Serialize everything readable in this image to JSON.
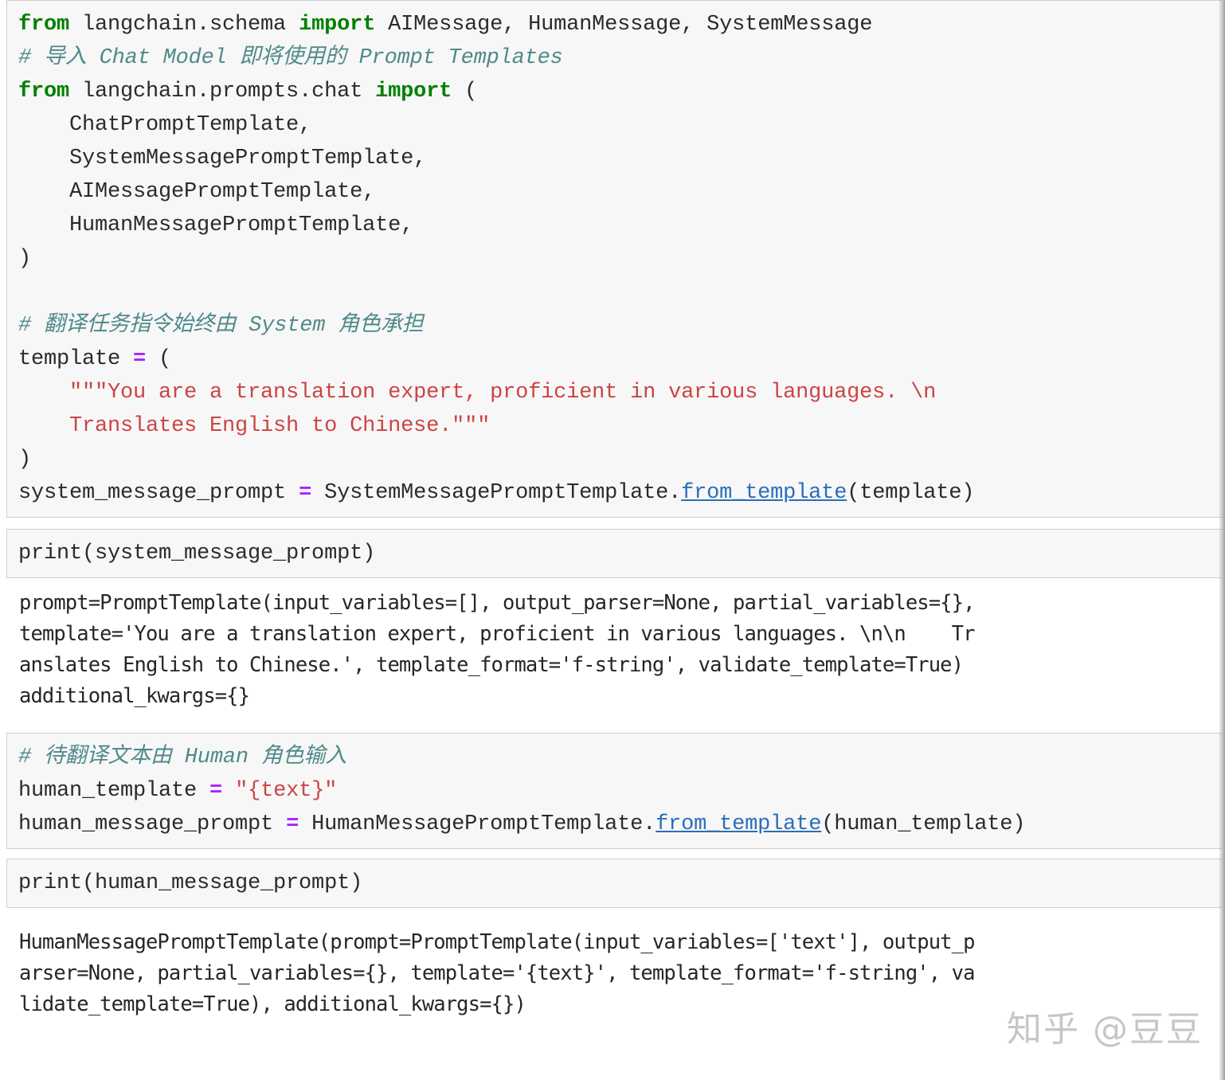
{
  "colors": {
    "keyword": "#008000",
    "comment": "#4f8a8b",
    "string": "#cc4444",
    "operator": "#aa22ff",
    "function": "#2a6ebb",
    "code_cell_bg": "#f7f7f7",
    "code_cell_border": "#cfcfcf",
    "page_bg": "#ffffff",
    "text": "#2b2b2b"
  },
  "watermark": {
    "text": "知乎 @豆豆"
  },
  "cells": [
    {
      "type": "code",
      "name": "code-cell-imports-and-system-template",
      "lines": [
        [
          {
            "t": "from",
            "c": "k"
          },
          {
            "t": " langchain.schema ",
            "c": ""
          },
          {
            "t": "import",
            "c": "k"
          },
          {
            "t": " AIMessage, HumanMessage, SystemMessage",
            "c": ""
          }
        ],
        [
          {
            "t": "# 导入 Chat Model 即将使用的 Prompt Templates",
            "c": "cm"
          }
        ],
        [
          {
            "t": "from",
            "c": "k"
          },
          {
            "t": " langchain.prompts.chat ",
            "c": ""
          },
          {
            "t": "import",
            "c": "k"
          },
          {
            "t": " (",
            "c": ""
          }
        ],
        [
          {
            "t": "    ChatPromptTemplate,",
            "c": ""
          }
        ],
        [
          {
            "t": "    SystemMessagePromptTemplate,",
            "c": ""
          }
        ],
        [
          {
            "t": "    AIMessagePromptTemplate,",
            "c": ""
          }
        ],
        [
          {
            "t": "    HumanMessagePromptTemplate,",
            "c": ""
          }
        ],
        [
          {
            "t": ")",
            "c": ""
          }
        ],
        [
          {
            "t": "",
            "c": ""
          }
        ],
        [
          {
            "t": "# 翻译任务指令始终由 System 角色承担",
            "c": "cm"
          }
        ],
        [
          {
            "t": "template ",
            "c": ""
          },
          {
            "t": "=",
            "c": "op"
          },
          {
            "t": " (",
            "c": ""
          }
        ],
        [
          {
            "t": "    \"\"\"You are a translation expert, proficient in various languages. \\n",
            "c": "s"
          }
        ],
        [
          {
            "t": "    Translates English to Chinese.\"\"\"",
            "c": "s"
          }
        ],
        [
          {
            "t": ")",
            "c": ""
          }
        ],
        [
          {
            "t": "system_message_prompt ",
            "c": ""
          },
          {
            "t": "=",
            "c": "op"
          },
          {
            "t": " SystemMessagePromptTemplate.",
            "c": ""
          },
          {
            "t": "from_template",
            "c": "fn"
          },
          {
            "t": "(template)",
            "c": ""
          }
        ]
      ]
    },
    {
      "type": "code",
      "name": "code-cell-print-system-message-prompt",
      "lines": [
        [
          {
            "t": "print(system_message_prompt)",
            "c": ""
          }
        ]
      ]
    },
    {
      "type": "output",
      "name": "output-cell-system-message-prompt",
      "lines": [
        "prompt=PromptTemplate(input_variables=[], output_parser=None, partial_variables={},",
        "template='You are a translation expert, proficient in various languages. \\n\\n    Tr",
        "anslates English to Chinese.', template_format='f-string', validate_template=True)",
        "additional_kwargs={}"
      ]
    },
    {
      "type": "code",
      "name": "code-cell-human-template",
      "lines": [
        [
          {
            "t": "# 待翻译文本由 Human 角色输入",
            "c": "cm"
          }
        ],
        [
          {
            "t": "human_template ",
            "c": ""
          },
          {
            "t": "=",
            "c": "op"
          },
          {
            "t": " ",
            "c": ""
          },
          {
            "t": "\"{text}\"",
            "c": "s"
          }
        ],
        [
          {
            "t": "human_message_prompt ",
            "c": ""
          },
          {
            "t": "=",
            "c": "op"
          },
          {
            "t": " HumanMessagePromptTemplate.",
            "c": ""
          },
          {
            "t": "from_template",
            "c": "fn"
          },
          {
            "t": "(human_template)",
            "c": ""
          }
        ]
      ]
    },
    {
      "type": "code",
      "name": "code-cell-print-human-message-prompt",
      "lines": [
        [
          {
            "t": "print(human_message_prompt)",
            "c": ""
          }
        ]
      ]
    },
    {
      "type": "output",
      "name": "output-cell-human-message-prompt",
      "lines": [
        "HumanMessagePromptTemplate(prompt=PromptTemplate(input_variables=['text'], output_p",
        "arser=None, partial_variables={}, template='{text}', template_format='f-string', va",
        "lidate_template=True), additional_kwargs={})"
      ]
    }
  ]
}
